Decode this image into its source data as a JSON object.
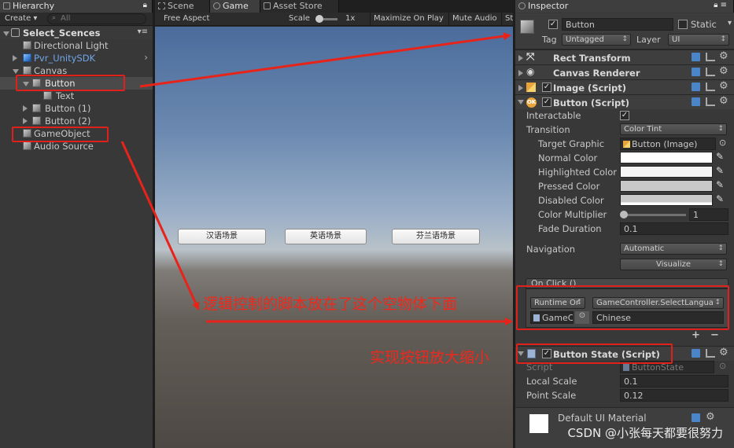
{
  "hierarchy": {
    "tab": "Hierarchy",
    "create_label": "Create",
    "search_placeholder": "All",
    "scene_name": "Select_Scences",
    "items": [
      {
        "label": "Directional Light"
      },
      {
        "label": "Pvr_UnitySDK"
      },
      {
        "label": "Canvas"
      },
      {
        "label": "Button"
      },
      {
        "label": "Text"
      },
      {
        "label": "Button (1)"
      },
      {
        "label": "Button (2)"
      },
      {
        "label": "GameObject"
      },
      {
        "label": "Audio Source"
      }
    ]
  },
  "center": {
    "tabs": [
      "Scene",
      "Game",
      "Asset Store"
    ],
    "aspect": "Free Aspect",
    "scale_label": "Scale",
    "scale_value": "1x",
    "maximize": "Maximize On Play",
    "mute": "Mute Audio",
    "stats": "St",
    "buttons": [
      "汉语场景",
      "英语场景",
      "芬兰语场景"
    ]
  },
  "inspector": {
    "tab": "Inspector",
    "object_name": "Button",
    "static_label": "Static",
    "tag_label": "Tag",
    "tag_value": "Untagged",
    "layer_label": "Layer",
    "layer_value": "UI",
    "components": {
      "rect": "Rect Transform",
      "canvas_renderer": "Canvas Renderer",
      "image": "Image (Script)",
      "button": "Button (Script)",
      "button_state": "Button State (Script)"
    },
    "button_props": {
      "interactable": "Interactable",
      "transition": "Transition",
      "transition_value": "Color Tint",
      "target_graphic": "Target Graphic",
      "target_graphic_value": "Button (Image)",
      "normal_color": "Normal Color",
      "highlighted_color": "Highlighted Color",
      "pressed_color": "Pressed Color",
      "disabled_color": "Disabled Color",
      "color_multiplier": "Color Multiplier",
      "color_multiplier_value": "1",
      "fade_duration": "Fade Duration",
      "fade_duration_value": "0.1",
      "navigation": "Navigation",
      "navigation_value": "Automatic",
      "visualize": "Visualize",
      "on_click": "On Click ()",
      "runtime": "Runtime Or",
      "function": "GameController.SelectLangua",
      "object": "GameC",
      "argument": "Chinese",
      "plus": "+",
      "minus": "−"
    },
    "state_props": {
      "script": "Script",
      "script_value": "ButtonState",
      "local_scale": "Local Scale",
      "local_scale_value": "0.1",
      "point_scale": "Point Scale",
      "point_scale_value": "0.12"
    },
    "material": "Default UI Material"
  },
  "annotations": {
    "note1": "逻辑控制的脚本放在了这个空物体下面",
    "note2": "实现按钮放大缩小",
    "watermark": "CSDN @小张每天都要很努力"
  }
}
